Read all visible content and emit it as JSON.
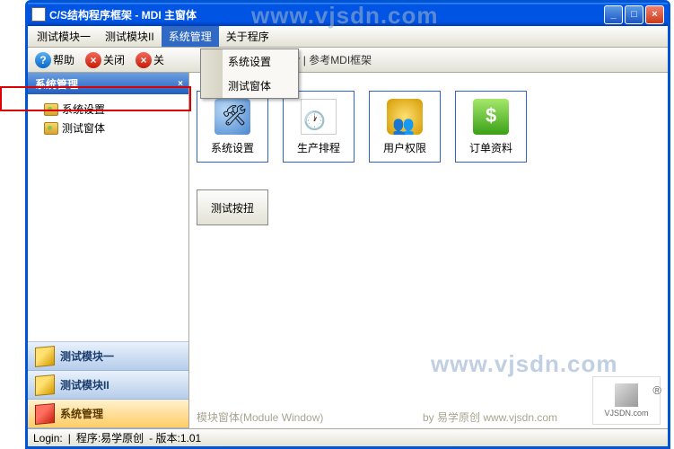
{
  "window": {
    "title": "C/S结构程序框架 - MDI 主窗体"
  },
  "menubar": {
    "items": [
      "测试模块一",
      "测试模块II",
      "系统管理",
      "关于程序"
    ],
    "active_index": 2
  },
  "dropdown": {
    "items": [
      "系统设置",
      "测试窗体"
    ]
  },
  "toolbar": {
    "help": "帮助",
    "close": "关闭",
    "close2": "关",
    "tail": "oolbar | 参考MDI框架"
  },
  "sidebar": {
    "header": "系统管理",
    "header_close": "×",
    "tree": [
      "系统设置",
      "测试窗体"
    ],
    "nav": [
      "测试模块一",
      "测试模块II",
      "系统管理"
    ],
    "nav_selected": 2
  },
  "tiles": [
    {
      "label": "系统设置",
      "icon": "settings"
    },
    {
      "label": "生产排程",
      "icon": "sched"
    },
    {
      "label": "用户权限",
      "icon": "perm"
    },
    {
      "label": "订单资料",
      "icon": "order"
    }
  ],
  "test_button": "测试按扭",
  "footer": {
    "module": "模块窗体(Module Window)",
    "by": "by 易学原创 www.vjsdn.com"
  },
  "statusbar": {
    "login": "Login:",
    "sep": "|",
    "program": "程序:易学原创",
    "version": "- 版本:1.01"
  },
  "watermark": "www.vjsdn.com",
  "logo": {
    "text": "VJSDN.com",
    "reg": "®"
  }
}
